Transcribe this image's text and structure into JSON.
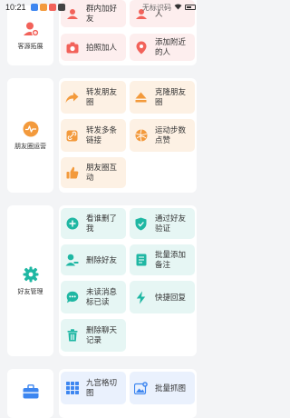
{
  "status_bar": {
    "time": "10:21",
    "overlay_text": "无标识码"
  },
  "categories": [
    {
      "label": "客源拓展"
    },
    {
      "label": "朋友圈运营"
    },
    {
      "label": "好友管理"
    },
    {
      "label": ""
    }
  ],
  "sections": {
    "acquire": [
      {
        "label": "群内加好友",
        "icon": "group-add-icon"
      },
      {
        "label": "人",
        "icon": "person-icon"
      },
      {
        "label": "拍照加人",
        "icon": "camera-icon"
      },
      {
        "label": "添加附近的人",
        "icon": "location-pin-icon"
      }
    ],
    "moments": [
      {
        "label": "转发朋友圈",
        "icon": "forward-icon"
      },
      {
        "label": "克隆朋友圈",
        "icon": "eject-icon"
      },
      {
        "label": "转发多条链接",
        "icon": "link-icon"
      },
      {
        "label": "运动步数点赞",
        "icon": "ball-icon"
      },
      {
        "label": "朋友圈互动",
        "icon": "thumbs-up-icon"
      }
    ],
    "friends": [
      {
        "label": "看谁删了我",
        "icon": "plus-circle-icon"
      },
      {
        "label": "通过好友验证",
        "icon": "shield-check-icon"
      },
      {
        "label": "删除好友",
        "icon": "user-remove-icon"
      },
      {
        "label": "批量添加备注",
        "icon": "note-icon"
      },
      {
        "label": "未读消息标已读",
        "icon": "chat-dots-icon"
      },
      {
        "label": "快捷回复",
        "icon": "lightning-icon"
      },
      {
        "label": "删除聊天记录",
        "icon": "trash-icon"
      }
    ],
    "tools": [
      {
        "label": "九宫格切图",
        "icon": "grid-icon"
      },
      {
        "label": "批量抓图",
        "icon": "image-add-icon"
      }
    ]
  },
  "colors": {
    "red": "#f2625a",
    "orange": "#f39a3c",
    "teal": "#1fb7a3",
    "blue": "#3d86f0"
  }
}
